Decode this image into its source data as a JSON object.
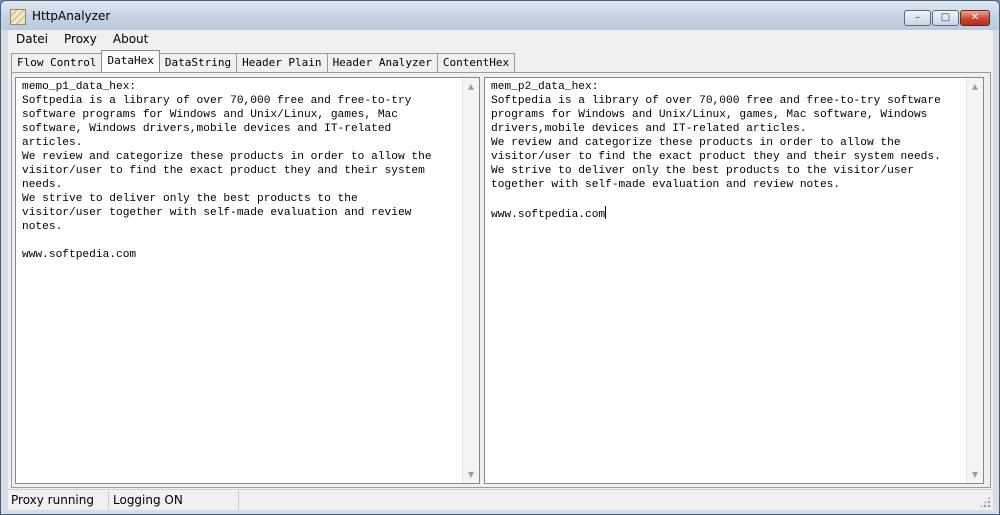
{
  "window": {
    "title": "HttpAnalyzer"
  },
  "menu": [
    "Datei",
    "Proxy",
    "About"
  ],
  "tabs": [
    {
      "label": "Flow Control",
      "active": false
    },
    {
      "label": "DataHex",
      "active": true
    },
    {
      "label": "DataString",
      "active": false
    },
    {
      "label": "Header Plain",
      "active": false
    },
    {
      "label": "Header Analyzer",
      "active": false
    },
    {
      "label": "ContentHex",
      "active": false
    }
  ],
  "memo_left": {
    "text": "memo_p1_data_hex:\nSoftpedia is a library of over 70,000 free and free-to-try\nsoftware programs for Windows and Unix/Linux, games, Mac\nsoftware, Windows drivers,mobile devices and IT-related\narticles.\nWe review and categorize these products in order to allow the\nvisitor/user to find the exact product they and their system\nneeds.\nWe strive to deliver only the best products to the\nvisitor/user together with self-made evaluation and review\nnotes.\n\nwww.softpedia.com"
  },
  "memo_right": {
    "text": "mem_p2_data_hex:\nSoftpedia is a library of over 70,000 free and free-to-try software\nprograms for Windows and Unix/Linux, games, Mac software, Windows\ndrivers,mobile devices and IT-related articles.\nWe review and categorize these products in order to allow the\nvisitor/user to find the exact product they and their system needs.\nWe strive to deliver only the best products to the visitor/user\ntogether with self-made evaluation and review notes.\n\nwww.softpedia.com"
  },
  "status": {
    "proxy": "Proxy running",
    "logging": "Logging ON"
  },
  "icons": {
    "up_arrow": "▲",
    "down_arrow": "▼",
    "minimize": "–",
    "maximize": "□",
    "close": "✕"
  }
}
